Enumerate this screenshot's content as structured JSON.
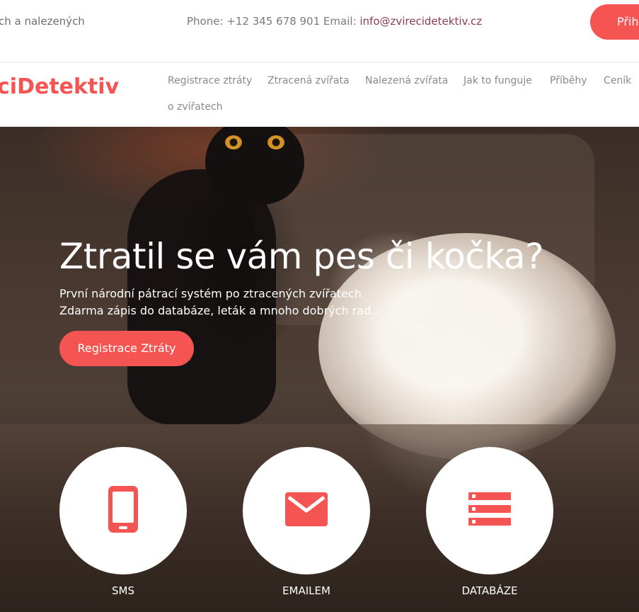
{
  "topbar": {
    "tagline": "ch a nalezených",
    "phone_label": "Phone: +12 345 678 901",
    "email_prefix": "Email:",
    "email": "info@zvirecidetektiv.cz",
    "login_label": "Přihl"
  },
  "navbar": {
    "logo": "ciDetektiv",
    "items": [
      "Registrace ztráty",
      "Ztracená zvířata",
      "Nalezená zvířata",
      "Jak to funguje",
      "Příběhy",
      "Ceník",
      "o zvířatech"
    ]
  },
  "hero": {
    "title": "Ztratil se vám pes či kočka?",
    "subtitle_line1": "První národní pátrací systém po ztracených zvířatech",
    "subtitle_line2": "Zdarma zápis do databáze, leták a mnoho dobrých rad...",
    "cta_label": "Registrace Ztráty"
  },
  "features": [
    {
      "icon": "phone-icon",
      "label": "SMS"
    },
    {
      "icon": "envelope-icon",
      "label": "EMAILEM"
    },
    {
      "icon": "database-icon",
      "label": "DATABÁZE"
    }
  ],
  "colors": {
    "accent": "#f45552",
    "email_link": "#8e3b52"
  }
}
